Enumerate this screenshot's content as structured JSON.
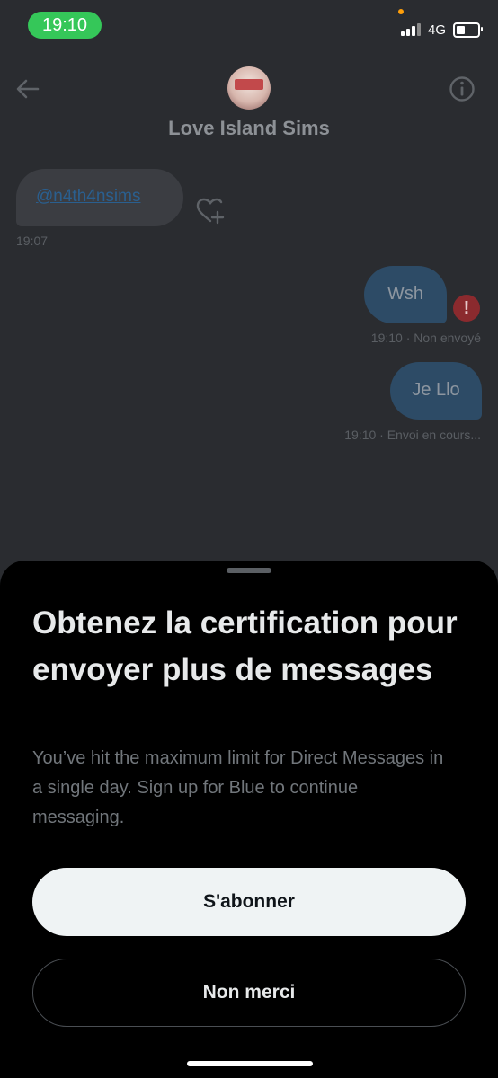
{
  "status_bar": {
    "time": "19:10",
    "network": "4G"
  },
  "header": {
    "title": "Love Island Sims"
  },
  "messages": {
    "received": {
      "text": "@n4th4nsims",
      "time": "19:07"
    },
    "sent1": {
      "text": "Wsh",
      "meta": "19:10 · Non envoyé",
      "error_glyph": "!"
    },
    "sent2": {
      "text": "Je Llo",
      "meta": "19:10 · Envoi en cours..."
    }
  },
  "sheet": {
    "title": "Obtenez la certification pour envoyer plus de messages",
    "description": "You’ve hit the maximum limit for Direct Messages in a single day. Sign up for Blue to continue messaging.",
    "primary_label": "S'abonner",
    "secondary_label": "Non merci"
  },
  "colors": {
    "accent_green": "#35c759",
    "error_red": "#8b2a2e",
    "sent_bubble": "#2d4b66"
  },
  "icons": [
    "back-arrow-icon",
    "info-icon",
    "heart-plus-icon",
    "error-icon",
    "signal-icon",
    "battery-icon"
  ]
}
